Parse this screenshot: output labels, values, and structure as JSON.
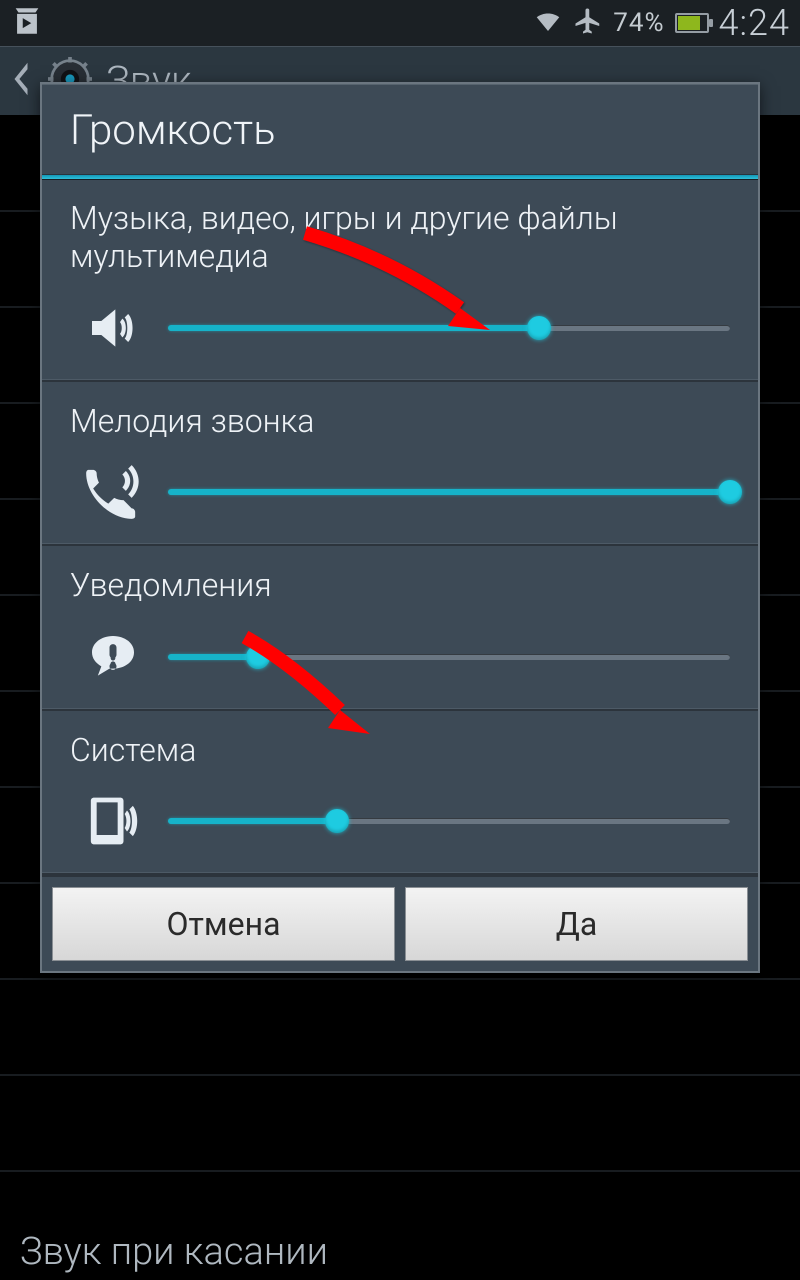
{
  "status": {
    "battery_pct": "74%",
    "time": "4:24"
  },
  "header": {
    "title": "Звук"
  },
  "background": {
    "touch_sound_label": "Звук при касании"
  },
  "dialog": {
    "title": "Громкость",
    "sections": [
      {
        "label": "Музыка, видео, игры и другие файлы мультимедиа",
        "icon": "speaker-icon",
        "value_pct": 66
      },
      {
        "label": "Мелодия звонка",
        "icon": "phone-ring-icon",
        "value_pct": 100
      },
      {
        "label": "Уведомления",
        "icon": "notification-icon",
        "value_pct": 16
      },
      {
        "label": "Система",
        "icon": "device-sound-icon",
        "value_pct": 30
      }
    ],
    "cancel_label": "Отмена",
    "ok_label": "Да"
  },
  "colors": {
    "accent": "#16b3c9",
    "dialog_bg": "#3d4a56"
  }
}
